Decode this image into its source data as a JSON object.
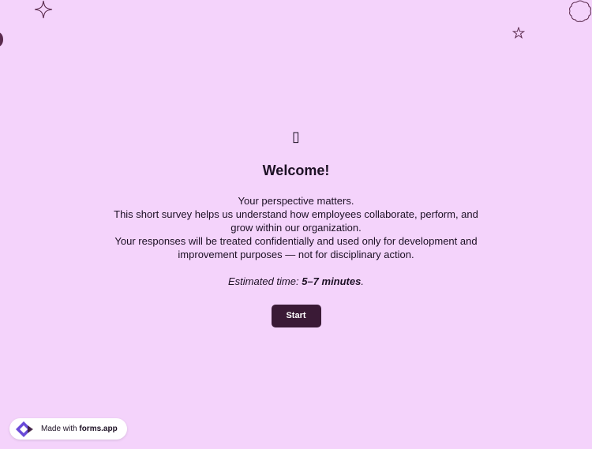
{
  "welcome": {
    "icon": "waving-hand-icon",
    "icon_glyph": "▯",
    "title": "Welcome!",
    "lines": [
      "Your perspective matters.",
      "This short survey helps us understand how employees collaborate, perform, and grow within our organization.",
      "Your responses will be treated confidentially and used only for development and improvement purposes — not for disciplinary action."
    ],
    "estimate_prefix": "Estimated time: ",
    "estimate_value": "5–7 minutes",
    "estimate_suffix": "."
  },
  "start_button": {
    "label": "Start"
  },
  "footer": {
    "made_with": "Made with",
    "brand": "forms.app",
    "logo_icon": "forms-app-logo-icon"
  },
  "colors": {
    "background": "#f4d3fb",
    "button": "#3a1a36",
    "text": "#1c1024",
    "logo_primary": "#6a4bd8"
  },
  "decorations": [
    "sparkle-icon",
    "star-icon",
    "cloud-icon",
    "half-circle-icon"
  ]
}
